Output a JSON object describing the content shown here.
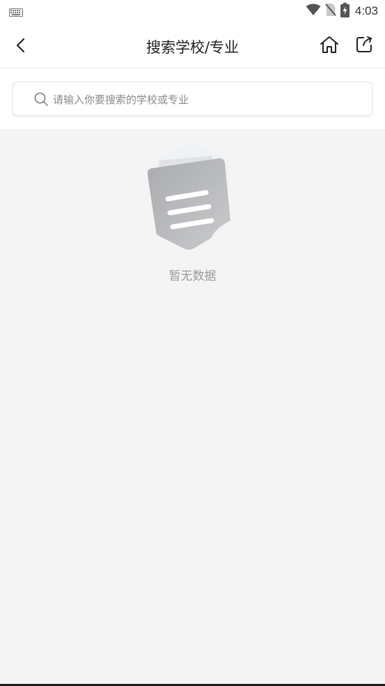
{
  "status_bar": {
    "time": "4:03",
    "icons": [
      "keyboard-icon",
      "wifi-icon",
      "no-sim-icon",
      "battery-charging-icon"
    ]
  },
  "header": {
    "title": "搜索学校/专业",
    "icons": [
      "back-arrow-icon",
      "home-icon",
      "share-icon"
    ]
  },
  "search": {
    "placeholder": "请输入你要搜索的学校或专业",
    "icon": "search-icon"
  },
  "empty_state": {
    "message": "暂无数据",
    "icon": "document-illustration-icon"
  },
  "colors": {
    "background": "#f4f4f5",
    "header_bg": "#ffffff",
    "text_primary": "#1f1f1f",
    "placeholder": "#8a8a8a",
    "empty_text": "#9a9a9a"
  }
}
